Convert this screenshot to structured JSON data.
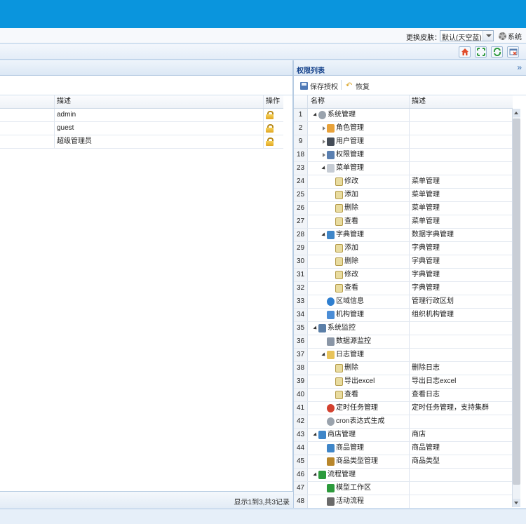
{
  "skin": {
    "label": "更换皮肤：",
    "selected": "默认(天空蓝)",
    "system": "系统"
  },
  "toolbar_icons": [
    "home-icon",
    "fullscreen-icon",
    "refresh-icon",
    "close-window-icon"
  ],
  "left_grid": {
    "headers": [
      "描述",
      "操作"
    ],
    "rows": [
      {
        "desc": "admin",
        "action": "lock-icon"
      },
      {
        "desc": "guest",
        "action": "lock-icon"
      },
      {
        "desc": "超级管理员",
        "action": "lock-icon"
      }
    ],
    "pager_text": "显示1到3,共3记录"
  },
  "right_panel": {
    "title": "权限列表",
    "save_label": "保存授权",
    "restore_label": "恢复",
    "headers": [
      "名称",
      "描述"
    ],
    "rows": [
      {
        "num": "1",
        "name": "系统管理",
        "desc": "",
        "level": 0,
        "toggle": "open",
        "icon": "gear-icon"
      },
      {
        "num": "2",
        "name": "角色管理",
        "desc": "",
        "level": 1,
        "toggle": "closed",
        "icon": "role-icon"
      },
      {
        "num": "9",
        "name": "用户管理",
        "desc": "",
        "level": 1,
        "toggle": "closed",
        "icon": "user-icon"
      },
      {
        "num": "18",
        "name": "权限管理",
        "desc": "",
        "level": 1,
        "toggle": "closed",
        "icon": "permission-icon"
      },
      {
        "num": "23",
        "name": "菜单管理",
        "desc": "",
        "level": 1,
        "toggle": "open",
        "icon": "menu-icon"
      },
      {
        "num": "24",
        "name": "修改",
        "desc": "菜单管理",
        "level": 2,
        "toggle": "none",
        "icon": "page-icon"
      },
      {
        "num": "25",
        "name": "添加",
        "desc": "菜单管理",
        "level": 2,
        "toggle": "none",
        "icon": "page-icon"
      },
      {
        "num": "26",
        "name": "删除",
        "desc": "菜单管理",
        "level": 2,
        "toggle": "none",
        "icon": "page-icon"
      },
      {
        "num": "27",
        "name": "查看",
        "desc": "菜单管理",
        "level": 2,
        "toggle": "none",
        "icon": "page-icon"
      },
      {
        "num": "28",
        "name": "字典管理",
        "desc": "数据字典管理",
        "level": 1,
        "toggle": "open",
        "icon": "dictionary-icon"
      },
      {
        "num": "29",
        "name": "添加",
        "desc": "字典管理",
        "level": 2,
        "toggle": "none",
        "icon": "page-icon"
      },
      {
        "num": "30",
        "name": "删除",
        "desc": "字典管理",
        "level": 2,
        "toggle": "none",
        "icon": "page-icon"
      },
      {
        "num": "31",
        "name": "修改",
        "desc": "字典管理",
        "level": 2,
        "toggle": "none",
        "icon": "page-icon"
      },
      {
        "num": "32",
        "name": "查看",
        "desc": "字典管理",
        "level": 2,
        "toggle": "none",
        "icon": "page-icon"
      },
      {
        "num": "33",
        "name": "区域信息",
        "desc": "管理行政区划",
        "level": 1,
        "toggle": "none",
        "icon": "globe-icon"
      },
      {
        "num": "34",
        "name": "机构管理",
        "desc": "组织机构管理",
        "level": 1,
        "toggle": "none",
        "icon": "house-icon"
      },
      {
        "num": "35",
        "name": "系统监控",
        "desc": "",
        "level": 0,
        "toggle": "open",
        "icon": "monitor-icon"
      },
      {
        "num": "36",
        "name": "数据源监控",
        "desc": "",
        "level": 1,
        "toggle": "none",
        "icon": "database-icon"
      },
      {
        "num": "37",
        "name": "日志管理",
        "desc": "",
        "level": 1,
        "toggle": "open",
        "icon": "folder-icon"
      },
      {
        "num": "38",
        "name": "删除",
        "desc": "删除日志",
        "level": 2,
        "toggle": "none",
        "icon": "page-icon"
      },
      {
        "num": "39",
        "name": "导出excel",
        "desc": "导出日志excel",
        "level": 2,
        "toggle": "none",
        "icon": "page-icon"
      },
      {
        "num": "40",
        "name": "查看",
        "desc": "查看日志",
        "level": 2,
        "toggle": "none",
        "icon": "page-icon"
      },
      {
        "num": "41",
        "name": "定时任务管理",
        "desc": "定时任务管理，支持集群",
        "level": 1,
        "toggle": "none",
        "icon": "clock-icon"
      },
      {
        "num": "42",
        "name": "cron表达式生成",
        "desc": "",
        "level": 1,
        "toggle": "none",
        "icon": "cron-icon"
      },
      {
        "num": "43",
        "name": "商店管理",
        "desc": "商店",
        "level": 0,
        "toggle": "open",
        "icon": "shop-folder-icon"
      },
      {
        "num": "44",
        "name": "商品管理",
        "desc": "商品管理",
        "level": 1,
        "toggle": "none",
        "icon": "puzzle-icon"
      },
      {
        "num": "45",
        "name": "商品类型管理",
        "desc": "商品类型",
        "level": 1,
        "toggle": "none",
        "icon": "signpost-icon"
      },
      {
        "num": "46",
        "name": "流程管理",
        "desc": "",
        "level": 0,
        "toggle": "open",
        "icon": "workflow-icon"
      },
      {
        "num": "47",
        "name": "模型工作区",
        "desc": "",
        "level": 1,
        "toggle": "none",
        "icon": "model-icon"
      },
      {
        "num": "48",
        "name": "活动流程",
        "desc": "",
        "level": 1,
        "toggle": "none",
        "icon": "process-icon"
      }
    ]
  },
  "colors": {
    "topbar": "#0a95dd",
    "header_text": "#15428b",
    "panel_border": "#b6cbe2"
  }
}
